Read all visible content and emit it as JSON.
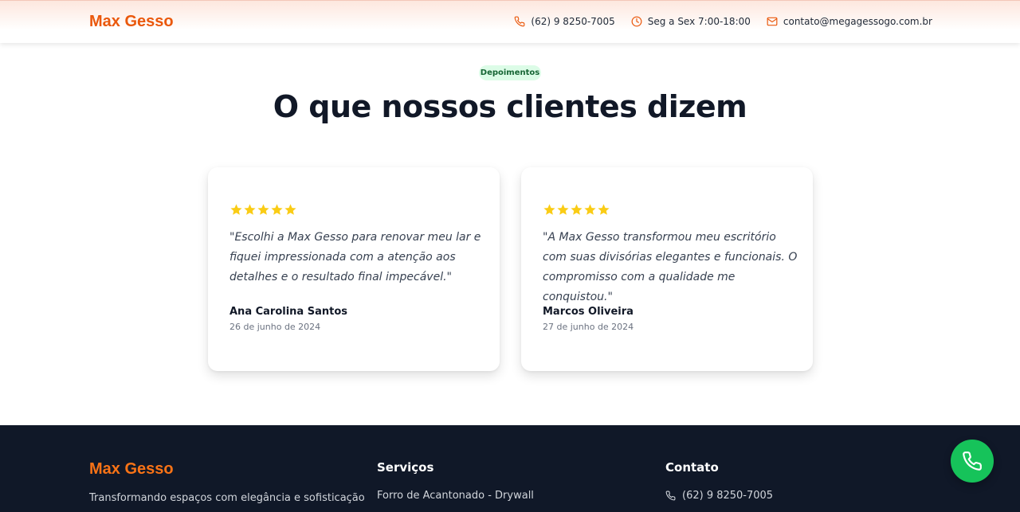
{
  "header": {
    "logo": "Max Gesso",
    "phone": "(62) 9 8250-7005",
    "hours": "Seg a Sex 7:00-18:00",
    "email": "contato@megagessogo.com.br"
  },
  "testimonials": {
    "badge": "Depoimentos",
    "title": "O que nossos clientes dizem",
    "items": [
      {
        "rating": 5,
        "quote": "\"Escolhi a Max Gesso para renovar meu lar e fiquei impressionada com a atenção aos detalhes e o resultado final impecável.\"",
        "author": "Ana Carolina Santos",
        "date": "26 de junho de 2024"
      },
      {
        "rating": 5,
        "quote": "\"A Max Gesso transformou meu escritório com suas divisórias elegantes e funcionais. O compromisso com a qualidade me conquistou.\"",
        "author": "Marcos Oliveira",
        "date": "27 de junho de 2024"
      }
    ]
  },
  "footer": {
    "brand": "Max Gesso",
    "tagline": "Transformando espaços com elegância e sofisticação",
    "services_heading": "Serviços",
    "services": [
      "Forro de Acantonado - Drywall"
    ],
    "contact_heading": "Contato",
    "contact_phone": "(62) 9 8250-7005"
  },
  "colors": {
    "brand": "#ea580c",
    "star": "#facc15",
    "footer_bg": "#101828",
    "whatsapp": "#16c35a"
  },
  "icons": {
    "phone": "phone-icon",
    "clock": "clock-icon",
    "mail": "mail-icon",
    "star": "star-icon",
    "call_button": "phone-call-icon"
  }
}
